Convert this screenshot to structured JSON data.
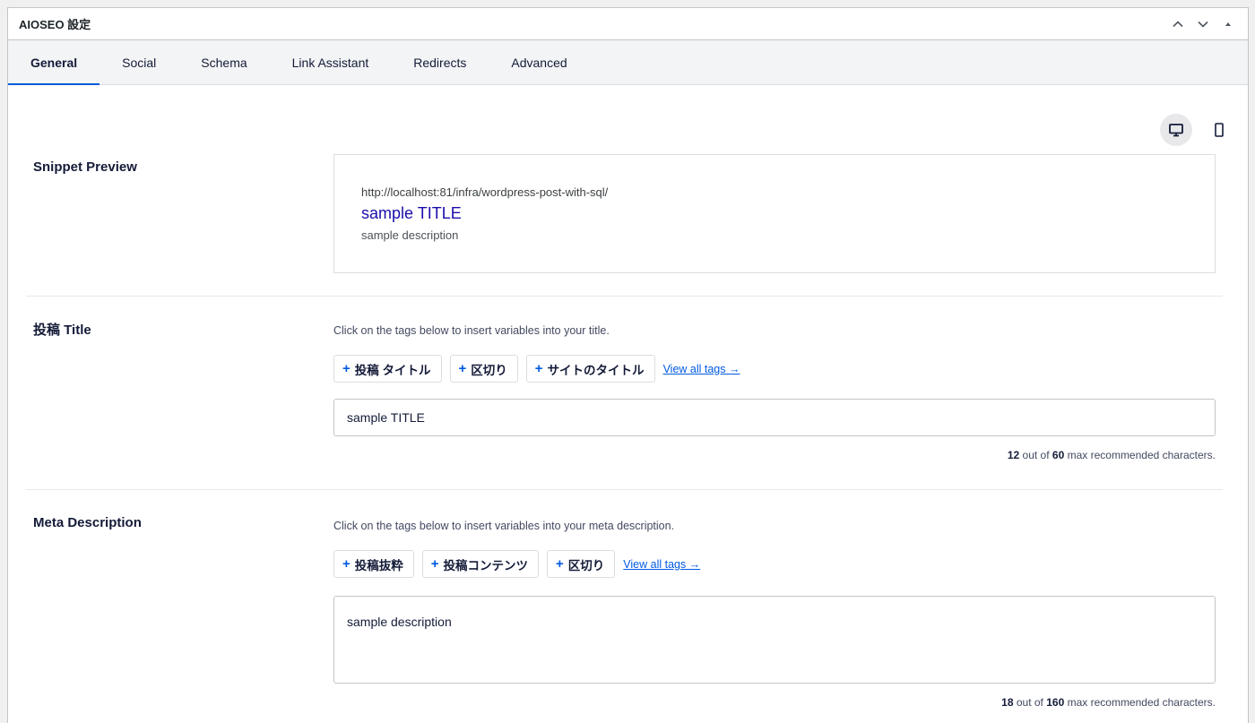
{
  "metabox": {
    "title": "AIOSEO 設定"
  },
  "tabs": [
    {
      "label": "General"
    },
    {
      "label": "Social"
    },
    {
      "label": "Schema"
    },
    {
      "label": "Link Assistant"
    },
    {
      "label": "Redirects"
    },
    {
      "label": "Advanced"
    }
  ],
  "snippet": {
    "label": "Snippet Preview",
    "url": "http://localhost:81/infra/wordpress-post-with-sql/",
    "title": "sample TITLE",
    "description": "sample description"
  },
  "post_title": {
    "label": "投稿 Title",
    "hint": "Click on the tags below to insert variables into your title.",
    "tags": [
      {
        "plus": "+",
        "label": "投稿 タイトル"
      },
      {
        "plus": "+",
        "label": "区切り"
      },
      {
        "plus": "+",
        "label": "サイトのタイトル"
      }
    ],
    "view_all": "View all tags →",
    "value": "sample TITLE",
    "count": "12",
    "max": "60",
    "counter_mid": "out of",
    "counter_tail": "max recommended characters."
  },
  "meta_description": {
    "label": "Meta Description",
    "hint": "Click on the tags below to insert variables into your meta description.",
    "tags": [
      {
        "plus": "+",
        "label": "投稿抜粋"
      },
      {
        "plus": "+",
        "label": "投稿コンテンツ"
      },
      {
        "plus": "+",
        "label": "区切り"
      }
    ],
    "view_all": "View all tags →",
    "value": "sample description",
    "count": "18",
    "max": "160",
    "counter_mid": "out of",
    "counter_tail": "max recommended characters."
  },
  "icons": {
    "collapse_up": "chevron-up-icon",
    "collapse_down": "chevron-down-icon",
    "toggle": "triangle-up-icon",
    "desktop": "desktop-icon",
    "mobile": "mobile-icon"
  },
  "colors": {
    "accent": "#005ae0",
    "snippet_title": "#1a0dab"
  }
}
